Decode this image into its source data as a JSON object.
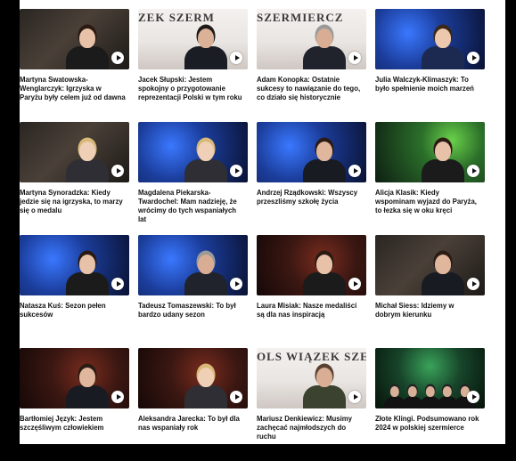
{
  "colors": {
    "page_background": "#000000",
    "panel_background": "#ffffff",
    "caption_text": "#111111",
    "play_button": "#ffffff"
  },
  "videos": [
    {
      "caption": "Martyna Swatowska-Wenglarczyk: Igrzyska w Paryżu były celem już od dawna",
      "overlay": "",
      "scene": "dark-studio",
      "person": "woman-dark"
    },
    {
      "caption": "Jacek Słupski: Jestem spokojny o przygotowanie reprezentacji Polski w tym roku",
      "overlay": "ZEK SZERM",
      "scene": "banner-white",
      "person": "man-glasses"
    },
    {
      "caption": "Adam Konopka: Ostatnie sukcesy to nawiązanie do tego, co działo się historycznie",
      "overlay": "SZERMIERCZ",
      "scene": "banner-white",
      "person": "man-grey"
    },
    {
      "caption": "Julia Walczyk-Klimaszyk: To było spełnienie moich marzeń",
      "overlay": "",
      "scene": "blue-logo",
      "person": "woman-uniform"
    },
    {
      "caption": "Martyna Synoradzka: Kiedy jedzie się na igrzyska, to marzy się o medalu",
      "overlay": "",
      "scene": "dark-studio",
      "person": "woman-blonde"
    },
    {
      "caption": "Magdalena Piekarska-Twardochel: Mam nadzieję, że wrócimy do tych wspaniałych lat",
      "overlay": "",
      "scene": "blue-logo",
      "person": "woman-blonde"
    },
    {
      "caption": "Andrzej Rządkowski: Wszyscy przeszliśmy szkołę życia",
      "overlay": "",
      "scene": "blue-logo",
      "person": "man-young"
    },
    {
      "caption": "Alicja Klasik: Kiedy wspominam wyjazd do Paryża, to łezka się w oku kręci",
      "overlay": "",
      "scene": "green-stage",
      "person": "woman-dark"
    },
    {
      "caption": "Natasza Kuś: Sezon pełen sukcesów",
      "overlay": "",
      "scene": "blue-logo",
      "person": "woman-dark"
    },
    {
      "caption": "Tadeusz Tomaszewski: To był bardzo udany sezon",
      "overlay": "",
      "scene": "blue-logo",
      "person": "man-grey"
    },
    {
      "caption": "Laura Misiak: Nasze medaliści są dla nas inspiracją",
      "overlay": "",
      "scene": "dark-red",
      "person": "woman-dark"
    },
    {
      "caption": "Michał Siess: Idziemy w dobrym kierunku",
      "overlay": "",
      "scene": "dark-studio",
      "person": "man-young"
    },
    {
      "caption": "Bartłomiej Język: Jestem szczęśliwym człowiekiem",
      "overlay": "",
      "scene": "dark-red",
      "person": "man-young"
    },
    {
      "caption": "Aleksandra Jarecka: To był dla nas wspaniały rok",
      "overlay": "",
      "scene": "dark-red",
      "person": "woman-blonde"
    },
    {
      "caption": "Mariusz Denkiewicz: Musimy zachęcać najmłodszych do ruchu",
      "overlay": "OLS WIĄZEK SZERMI",
      "scene": "banner-white",
      "person": "man-uniform"
    },
    {
      "caption": "Złote Klingi. Podsumowano rok 2024 w polskiej szermierce",
      "overlay": "",
      "scene": "group-stage",
      "person": "group"
    }
  ]
}
